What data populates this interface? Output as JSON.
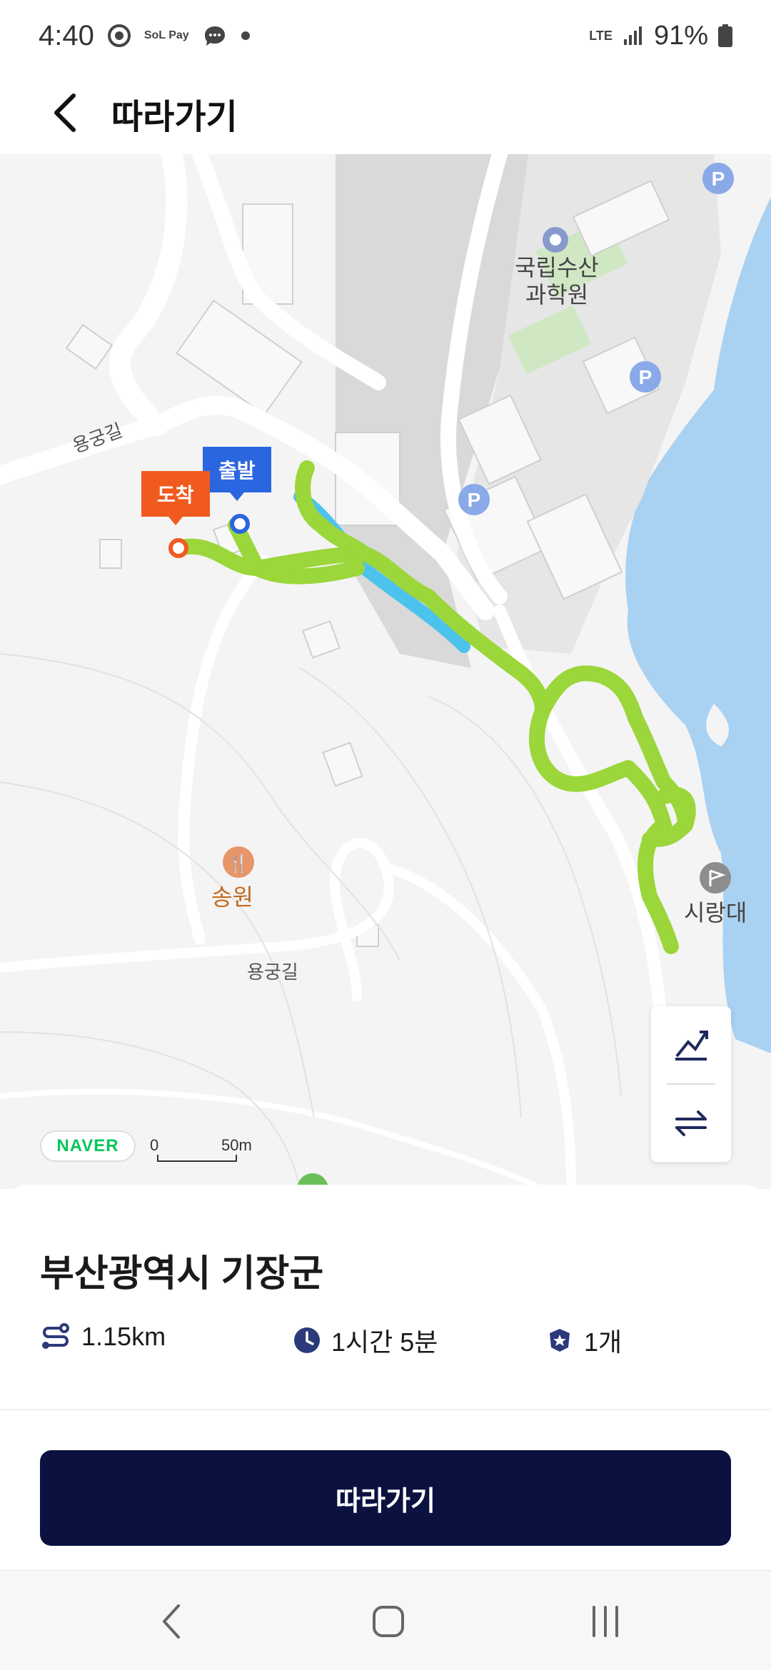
{
  "status_bar": {
    "time": "4:40",
    "icons": [
      "chrome-icon",
      "sol-pay-icon",
      "chat-icon",
      "notification-dot-icon"
    ],
    "sol_pay_label": "SoL Pay",
    "network": "LTE",
    "battery": "91%"
  },
  "header": {
    "title": "따라가기",
    "back_icon": "chevron-left-icon"
  },
  "map": {
    "provider_logo": "NAVER",
    "scale": {
      "start": "0",
      "end": "50m"
    },
    "labels": {
      "institute": "국립수산\n과학원",
      "restaurant": "송원",
      "viewpoint": "시랑대",
      "road_1": "용궁길",
      "road_2": "용궁길"
    },
    "markers": {
      "start": "출발",
      "end": "도착"
    },
    "route_color": "#9bd63a",
    "overlay_color": "#4cc3ec",
    "controls": [
      "elevation-chart-icon",
      "swap-direction-icon"
    ]
  },
  "course": {
    "region": "부산광역시 기장군",
    "distance": "1.15km",
    "duration": "1시간 5분",
    "stamps": "1개"
  },
  "actions": {
    "follow_button": "따라가기"
  },
  "nav_bar": {
    "buttons": [
      "back-nav-icon",
      "home-nav-icon",
      "recents-nav-icon"
    ]
  }
}
